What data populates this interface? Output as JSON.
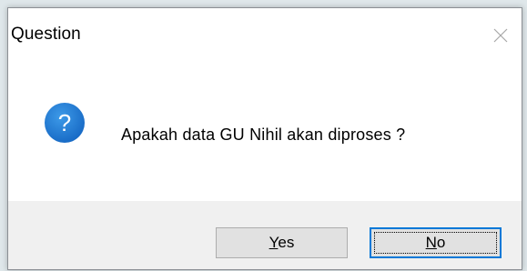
{
  "window": {
    "title": "Question",
    "close_icon": "close-icon"
  },
  "message": {
    "icon": "question-icon",
    "icon_color": "#1b7fd6",
    "text": "Apakah data GU Nihil akan diproses ?"
  },
  "buttons": {
    "yes": {
      "mnemonic": "Y",
      "rest": "es"
    },
    "no": {
      "mnemonic": "N",
      "rest": "o"
    },
    "default_focus": "No",
    "focus_color": "#0078d7"
  }
}
